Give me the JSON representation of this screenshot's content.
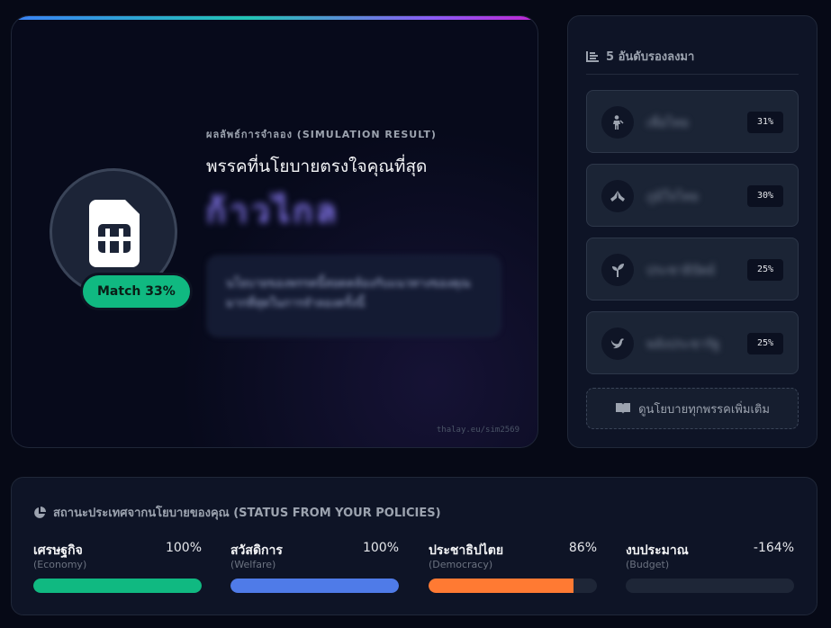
{
  "result": {
    "sim_label": "ผลลัพธ์การจำลอง (SIMULATION RESULT)",
    "heading": "พรรคที่นโยบายตรงใจคุณที่สุด",
    "party_name": "ก้าวไกล",
    "description": "นโยบายของพรรคนี้สอดคล้องกับแนวทางของคุณมากที่สุดในการจำลองครั้งนี้",
    "match_badge": "Match 33%",
    "match_percent": 33,
    "footer_link": "thalay.eu/sim2569",
    "icon": "sim-card-icon",
    "accent": "#10b981"
  },
  "ranking": {
    "title": "5 อันดับรองลงมา",
    "icon": "ranking-list-icon",
    "items": [
      {
        "name": "เพื่อไทย",
        "percent": "31%",
        "icon": "person-icon"
      },
      {
        "name": "ภูมิใจไทย",
        "percent": "30%",
        "icon": "hands-icon"
      },
      {
        "name": "ประชาธิปัตย์",
        "percent": "25%",
        "icon": "sprout-icon"
      },
      {
        "name": "พลังประชารัฐ",
        "percent": "25%",
        "icon": "bird-icon"
      }
    ],
    "more_button": "ดูนโยบายทุกพรรคเพิ่มเติม",
    "more_icon": "book-icon"
  },
  "status": {
    "title": "สถานะประเทศจากนโยบายของคุณ (STATUS FROM YOUR POLICIES)",
    "icon": "pie-chart-icon",
    "stats": [
      {
        "title": "เศรษฐกิจ",
        "subtitle": "(Economy)",
        "value": "100%",
        "fill": 100,
        "color": "#10b981"
      },
      {
        "title": "สวัสดิการ",
        "subtitle": "(Welfare)",
        "value": "100%",
        "fill": 100,
        "color": "#4f7be8"
      },
      {
        "title": "ประชาธิปไตย",
        "subtitle": "(Democracy)",
        "value": "86%",
        "fill": 86,
        "color": "#ff7a33"
      },
      {
        "title": "งบประมาณ",
        "subtitle": "(Budget)",
        "value": "-164%",
        "fill": 0,
        "color": "#1e2637"
      }
    ]
  }
}
